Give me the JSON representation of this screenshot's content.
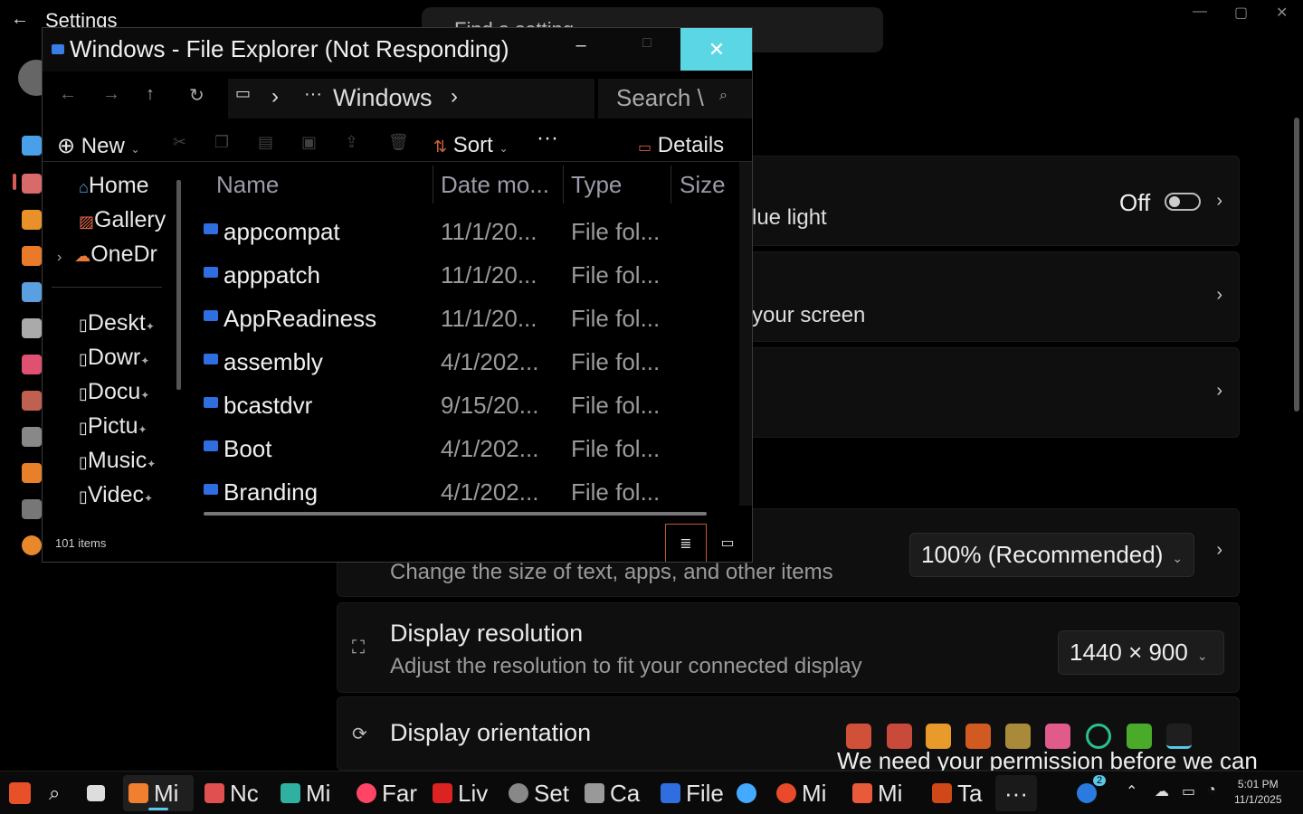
{
  "settings": {
    "back_icon": "back-arrow-icon",
    "title": "Settings",
    "search_placeholder": "Find a setting",
    "window_controls": {
      "minimize": "—",
      "maximize": "▢",
      "close": "✕"
    },
    "night_light": {
      "title_partial": "lue light",
      "state": "Off"
    },
    "scale_sub_partial": "your screen",
    "scale": {
      "subtitle": "Change the size of text, apps, and other items",
      "value": "100% (Recommended)"
    },
    "resolution": {
      "title": "Display resolution",
      "subtitle": "Adjust the resolution to fit your connected display",
      "value": "1440 × 900"
    },
    "orientation": {
      "title": "Display orientation"
    }
  },
  "explorer": {
    "title": "Windows - File Explorer (Not Responding)",
    "controls": {
      "minimize": "–",
      "maximize": "□",
      "close": "✕"
    },
    "address": {
      "segments": [
        "Windows"
      ],
      "more": "···"
    },
    "search_placeholder": "Search \\",
    "commands": {
      "new": "New",
      "sort": "Sort",
      "more": "···",
      "details": "Details"
    },
    "sidebar": {
      "top": [
        {
          "label": "Home",
          "icon": "home-icon"
        },
        {
          "label": "Gallery",
          "icon": "gallery-icon"
        },
        {
          "label": "OneDr",
          "icon": "onedrive-icon"
        }
      ],
      "pinned": [
        {
          "label": "Deskt",
          "icon": "desktop-icon"
        },
        {
          "label": "Dowr",
          "icon": "downloads-icon"
        },
        {
          "label": "Docu",
          "icon": "documents-icon"
        },
        {
          "label": "Pictu",
          "icon": "pictures-icon"
        },
        {
          "label": "Music",
          "icon": "music-icon"
        },
        {
          "label": "Videc",
          "icon": "videos-icon"
        }
      ]
    },
    "columns": {
      "name": "Name",
      "date": "Date mo...",
      "type": "Type",
      "size": "Size"
    },
    "rows": [
      {
        "name": "appcompat",
        "date": "11/1/20...",
        "type": "File fol..."
      },
      {
        "name": "apppatch",
        "date": "11/1/20...",
        "type": "File fol..."
      },
      {
        "name": "AppReadiness",
        "date": "11/1/20...",
        "type": "File fol..."
      },
      {
        "name": "assembly",
        "date": "4/1/202...",
        "type": "File fol..."
      },
      {
        "name": "bcastdvr",
        "date": "9/15/20...",
        "type": "File fol..."
      },
      {
        "name": "Boot",
        "date": "4/1/202...",
        "type": "File fol..."
      },
      {
        "name": "Branding",
        "date": "4/1/202...",
        "type": "File fol..."
      }
    ],
    "status": {
      "count": "101 items"
    }
  },
  "toast": {
    "text": "We need your permission before we can"
  },
  "taskbar": {
    "items": [
      {
        "label": "Mi",
        "color": "#f08030"
      },
      {
        "label": "Nc",
        "color": "#e05050"
      },
      {
        "label": "Mi",
        "color": "#30b0a0"
      },
      {
        "label": "Far",
        "color": "#ff4466"
      },
      {
        "label": "Liv",
        "color": "#dd2222"
      },
      {
        "label": "Set",
        "color": "#888888"
      },
      {
        "label": "Ca",
        "color": "#999999"
      },
      {
        "label": "File",
        "color": "#2f6ee0"
      },
      {
        "label": "",
        "color": "#44aaff"
      },
      {
        "label": "Mi",
        "color": "#e84a2a"
      },
      {
        "label": "Mi",
        "color": "#e85a3a"
      },
      {
        "label": "Ta",
        "color": "#d04818"
      }
    ],
    "more": "···",
    "badge": "2",
    "clock": {
      "time": "5:01 PM",
      "date": "11/1/2025"
    }
  }
}
